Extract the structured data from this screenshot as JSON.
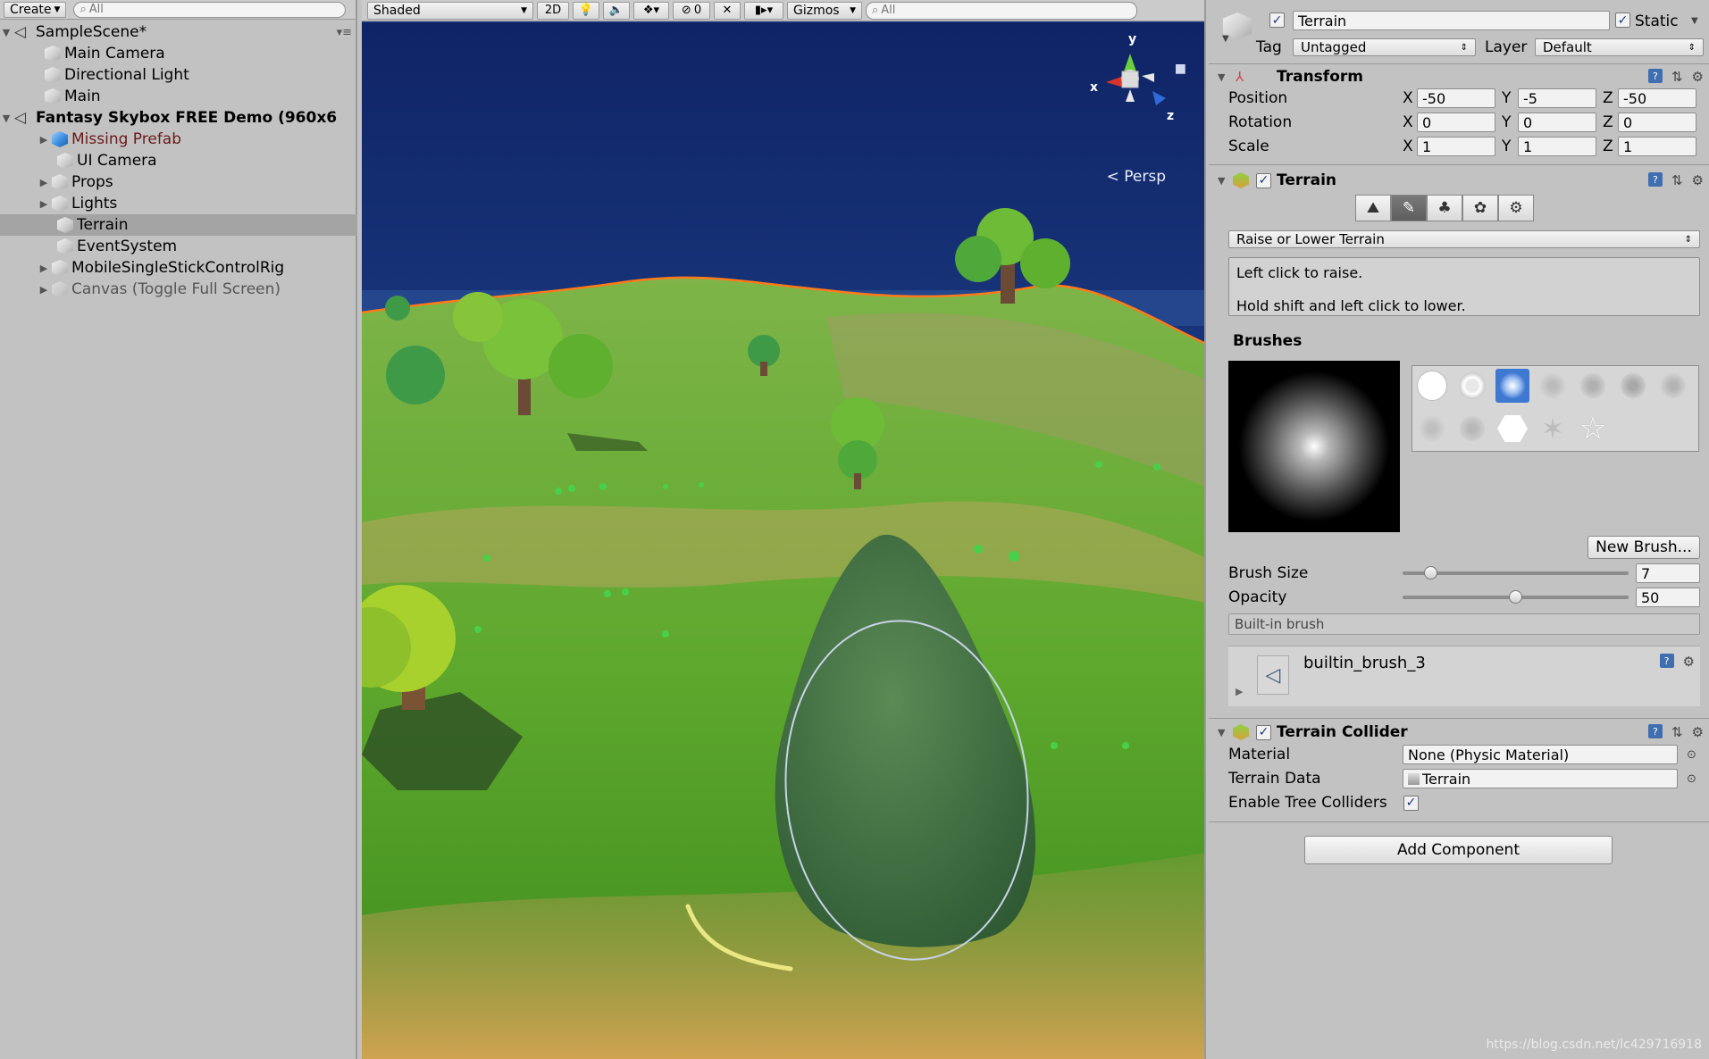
{
  "hierarchy": {
    "create_label": "Create",
    "search_placeholder": "All",
    "scene_name": "SampleScene*",
    "scene_objects": [
      "Main Camera",
      "Directional Light",
      "Main"
    ],
    "demo_scene_name": "Fantasy Skybox FREE Demo (960x6",
    "demo_objects": [
      {
        "label": "Missing Prefab",
        "expandable": true,
        "state": "missing"
      },
      {
        "label": "UI Camera",
        "expandable": false,
        "state": "normal"
      },
      {
        "label": "Props",
        "expandable": true,
        "state": "normal"
      },
      {
        "label": "Lights",
        "expandable": true,
        "state": "normal"
      },
      {
        "label": "Terrain",
        "expandable": false,
        "state": "selected"
      },
      {
        "label": "EventSystem",
        "expandable": false,
        "state": "normal"
      },
      {
        "label": "MobileSingleStickControlRig",
        "expandable": true,
        "state": "normal"
      },
      {
        "label": "Canvas (Toggle Full Screen)",
        "expandable": true,
        "state": "inactive"
      }
    ]
  },
  "scene_toolbar": {
    "shading_mode": "Shaded",
    "mode_2d": "2D",
    "hidden_count": "0",
    "gizmos_label": "Gizmos",
    "search_placeholder": "All"
  },
  "scene_view": {
    "projection_label": "Persp",
    "axis_y": "y",
    "axis_x": "x",
    "axis_z": "z",
    "colors": {
      "sky": "#1f3f85",
      "grass": "#5aa82a",
      "selection_outline": "#ff7a1a"
    }
  },
  "inspector": {
    "object_name": "Terrain",
    "static_label": "Static",
    "tag_label": "Tag",
    "tag_value": "Untagged",
    "layer_label": "Layer",
    "layer_value": "Default",
    "transform": {
      "title": "Transform",
      "position_label": "Position",
      "rotation_label": "Rotation",
      "scale_label": "Scale",
      "position": {
        "x": "-50",
        "y": "-5",
        "z": "-50"
      },
      "rotation": {
        "x": "0",
        "y": "0",
        "z": "0"
      },
      "scale": {
        "x": "1",
        "y": "1",
        "z": "1"
      }
    },
    "terrain": {
      "title": "Terrain",
      "tool_dropdown": "Raise or Lower Terrain",
      "help_line1": "Left click to raise.",
      "help_line2": "Hold shift and left click to lower.",
      "brushes_label": "Brushes",
      "new_brush_label": "New Brush...",
      "brush_size_label": "Brush Size",
      "brush_size_value": "7",
      "brush_size_fraction": 0.1,
      "opacity_label": "Opacity",
      "opacity_value": "50",
      "opacity_fraction": 0.5,
      "brush_type": "Built-in brush",
      "brush_asset_name": "builtin_brush_3"
    },
    "terrain_collider": {
      "title": "Terrain Collider",
      "material_label": "Material",
      "material_value": "None (Physic Material)",
      "terrain_data_label": "Terrain Data",
      "terrain_data_value": "Terrain",
      "tree_colliders_label": "Enable Tree Colliders"
    },
    "add_component_label": "Add Component"
  },
  "watermark": "https://blog.csdn.net/lc429716918"
}
